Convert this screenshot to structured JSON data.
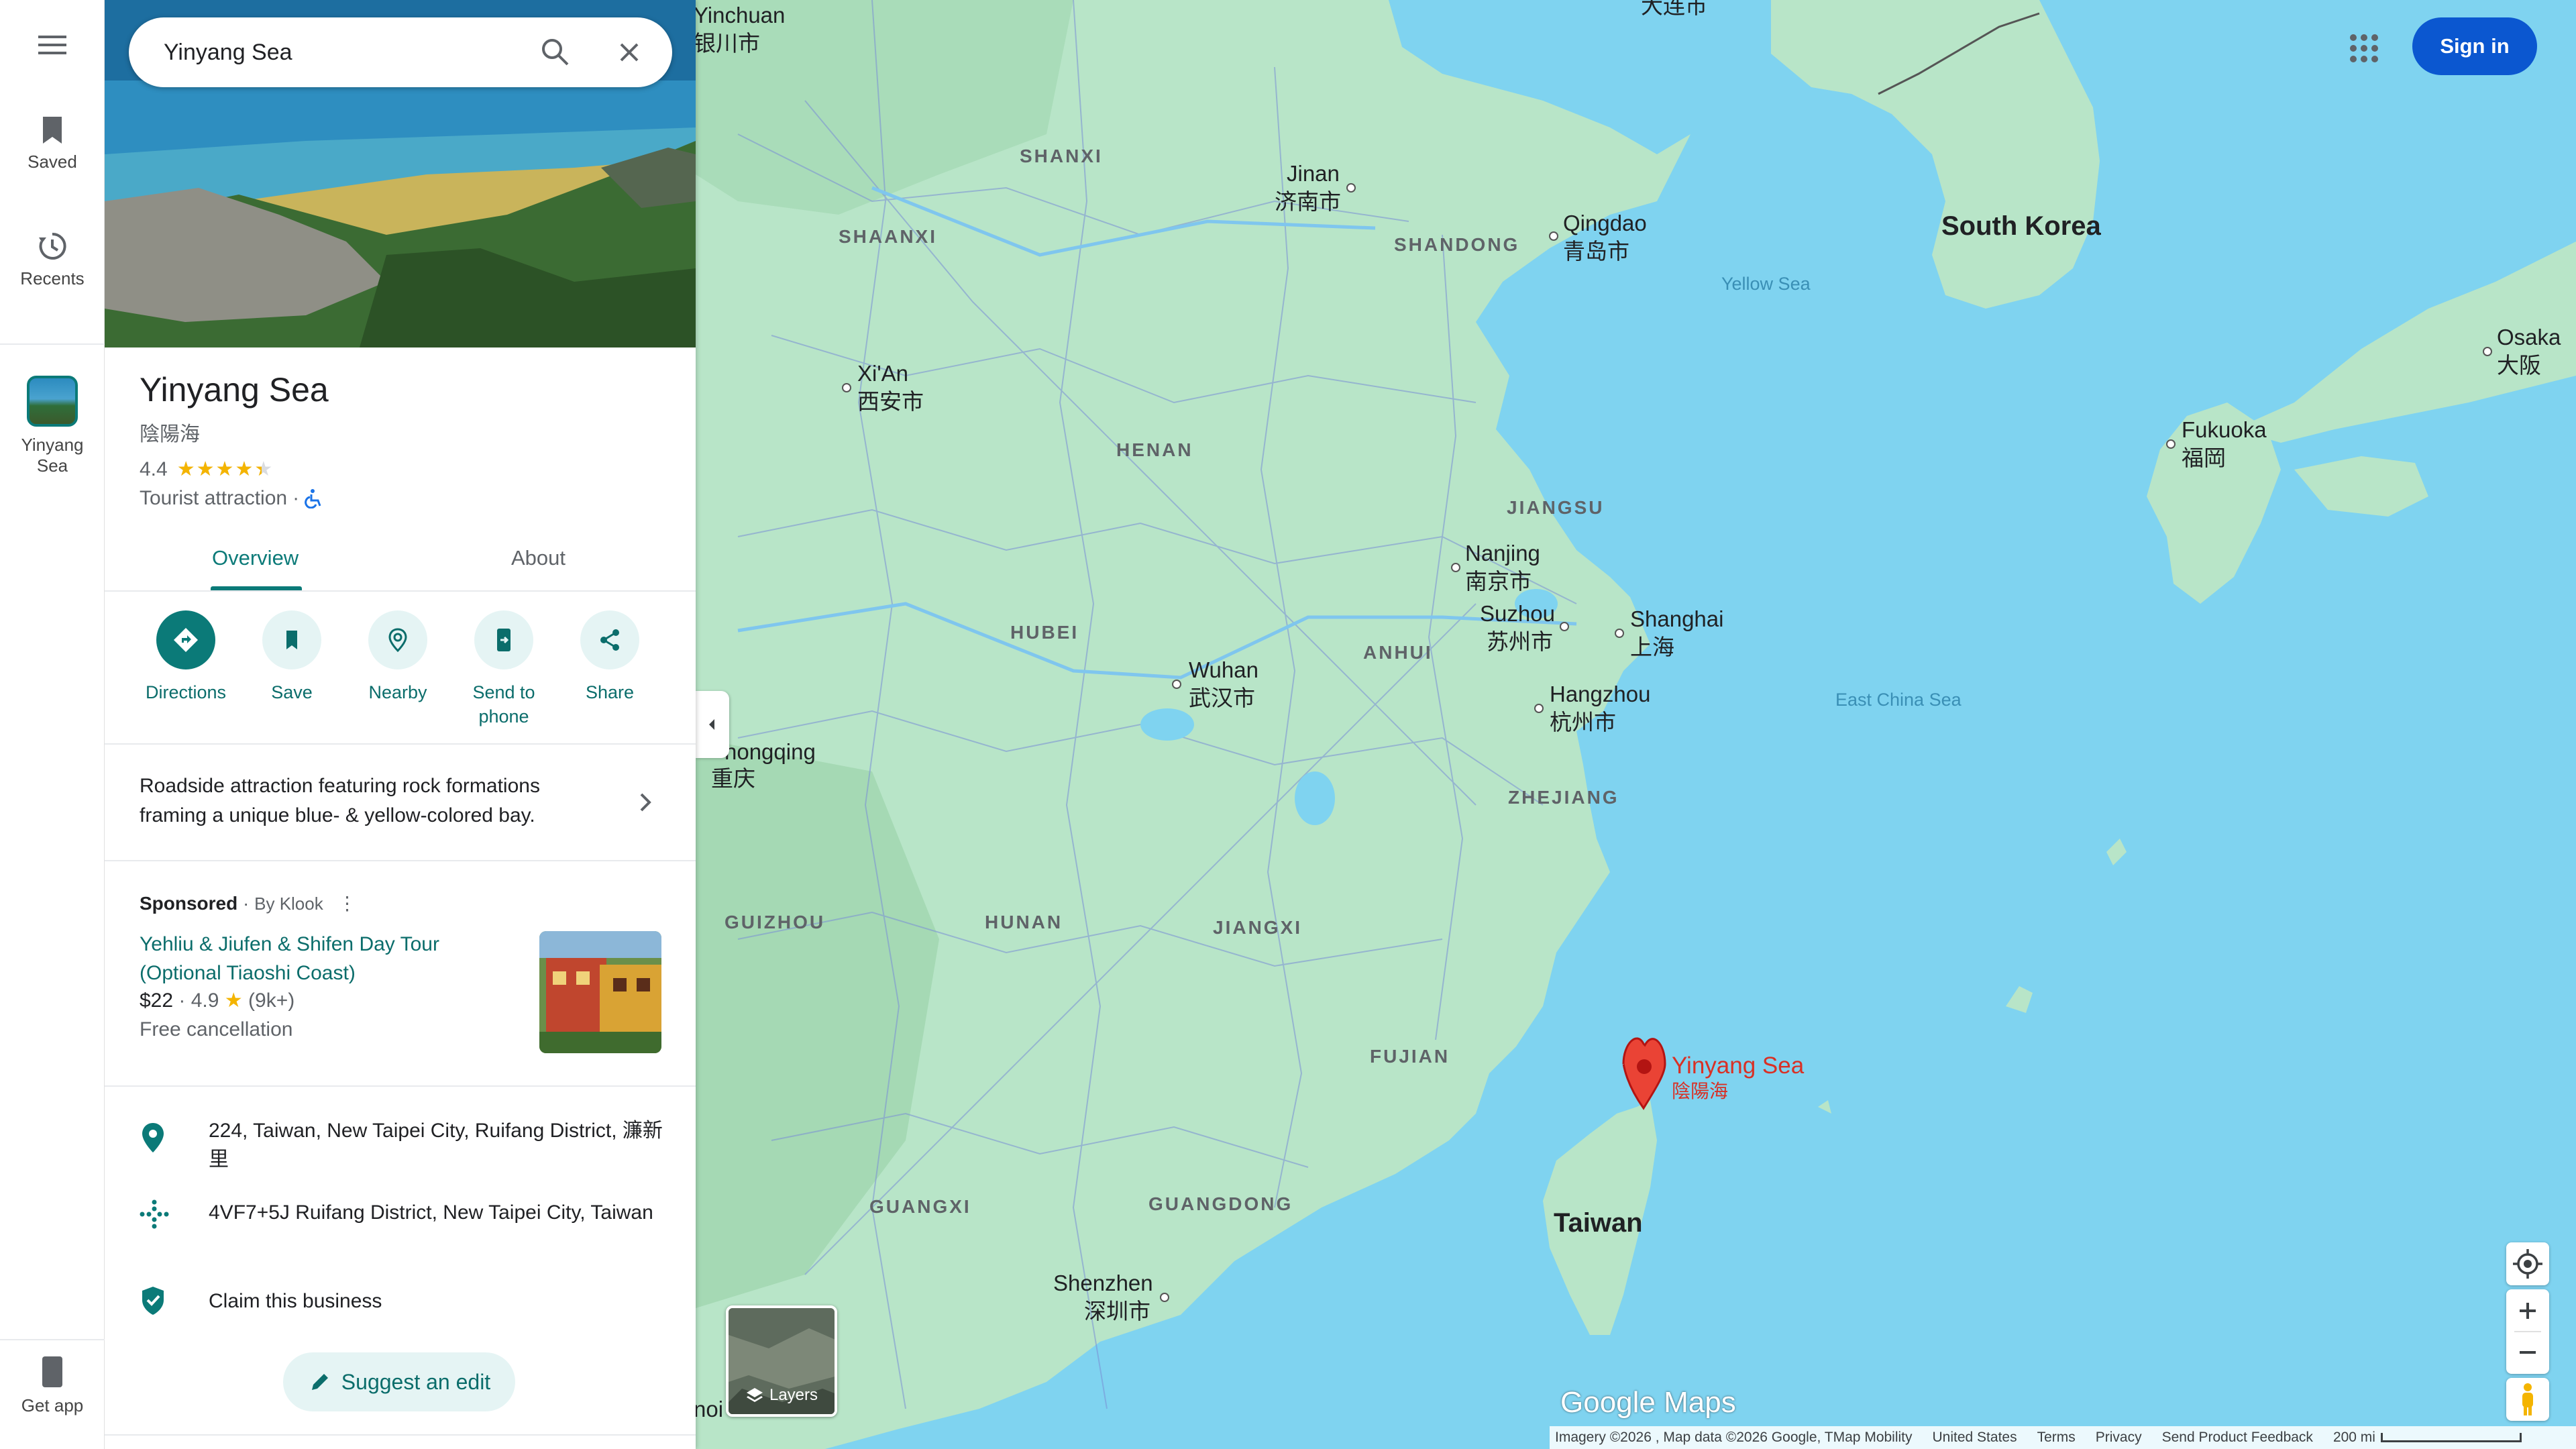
{
  "search": {
    "value": "Yinyang Sea"
  },
  "rail": {
    "saved": "Saved",
    "recents": "Recents",
    "place_line1": "Yinyang",
    "place_line2": "Sea",
    "get_app": "Get app"
  },
  "place": {
    "title": "Yinyang Sea",
    "native_name": "陰陽海",
    "rating": "4.4",
    "stars": 4.4,
    "category": "Tourist attraction",
    "tabs": [
      "Overview",
      "About"
    ],
    "actions": [
      "Directions",
      "Save",
      "Nearby",
      "Send to",
      "phone",
      "Share"
    ],
    "description": "Roadside attraction featuring rock formations framing a unique blue- & yellow-colored bay."
  },
  "sponsored": {
    "label": "Sponsored",
    "by": "By Klook",
    "title": "Yehliu & Jiufen & Shifen Day Tour (Optional Tiaoshi Coast)",
    "price": "$22",
    "rating": "4.9",
    "reviews": "(9k+)",
    "cancellation": "Free cancellation"
  },
  "info": {
    "address": "224, Taiwan, New Taipei City, Ruifang District, 濂新里",
    "plus_code": "4VF7+5J Ruifang District, New Taipei City, Taiwan",
    "claim": "Claim this business",
    "suggest_edit": "Suggest an edit"
  },
  "header": {
    "sign_in": "Sign in"
  },
  "map": {
    "layers": "Layers",
    "logo": "Google Maps",
    "pin_label": "Yinyang Sea",
    "pin_label_native": "陰陽海",
    "regions": [
      "SHANXI",
      "SHAANXI",
      "SHANDONG",
      "HENAN",
      "JIANGSU",
      "ANHUI",
      "HUBEI",
      "ZHEJIANG",
      "GUIZHOU",
      "HUNAN",
      "JIANGXI",
      "FUJIAN",
      "GUANGXI",
      "GUANGDONG"
    ],
    "cities": [
      {
        "en": "Yinchuan",
        "cn": "银川市"
      },
      {
        "en": "Jinan",
        "cn": "济南市"
      },
      {
        "en": "Qingdao",
        "cn": "青岛市"
      },
      {
        "en": "Xi'An",
        "cn": "西安市"
      },
      {
        "en": "Nanjing",
        "cn": "南京市"
      },
      {
        "en": "Suzhou",
        "cn": "苏州市"
      },
      {
        "en": "Shanghai",
        "cn": "上海"
      },
      {
        "en": "Hangzhou",
        "cn": "杭州市"
      },
      {
        "en": "Wuhan",
        "cn": "武汉市"
      },
      {
        "en": "hongqing",
        "cn": "重庆"
      },
      {
        "en": "Shenzhen",
        "cn": "深圳市"
      },
      {
        "en": "Fukuoka",
        "cn": "福岡"
      },
      {
        "en": "Osaka",
        "cn": "大阪"
      },
      {
        "en": "",
        "cn": "大连市"
      }
    ],
    "countries": [
      "South Korea",
      "Taiwan"
    ],
    "seas": [
      "Yellow Sea",
      "East China Sea"
    ],
    "edge_text": "noi"
  },
  "footer": {
    "imagery": "Imagery ©2026 , Map data ©2026 Google, TMap Mobility",
    "region": "United States",
    "terms": "Terms",
    "privacy": "Privacy",
    "feedback": "Send Product Feedback",
    "scale": "200 mi"
  },
  "colors": {
    "accent": "#0b7a78",
    "sign_in": "#0b57d0",
    "pin": "#ea4335",
    "land": "#b5e3c6",
    "water": "#7fd3f0"
  }
}
